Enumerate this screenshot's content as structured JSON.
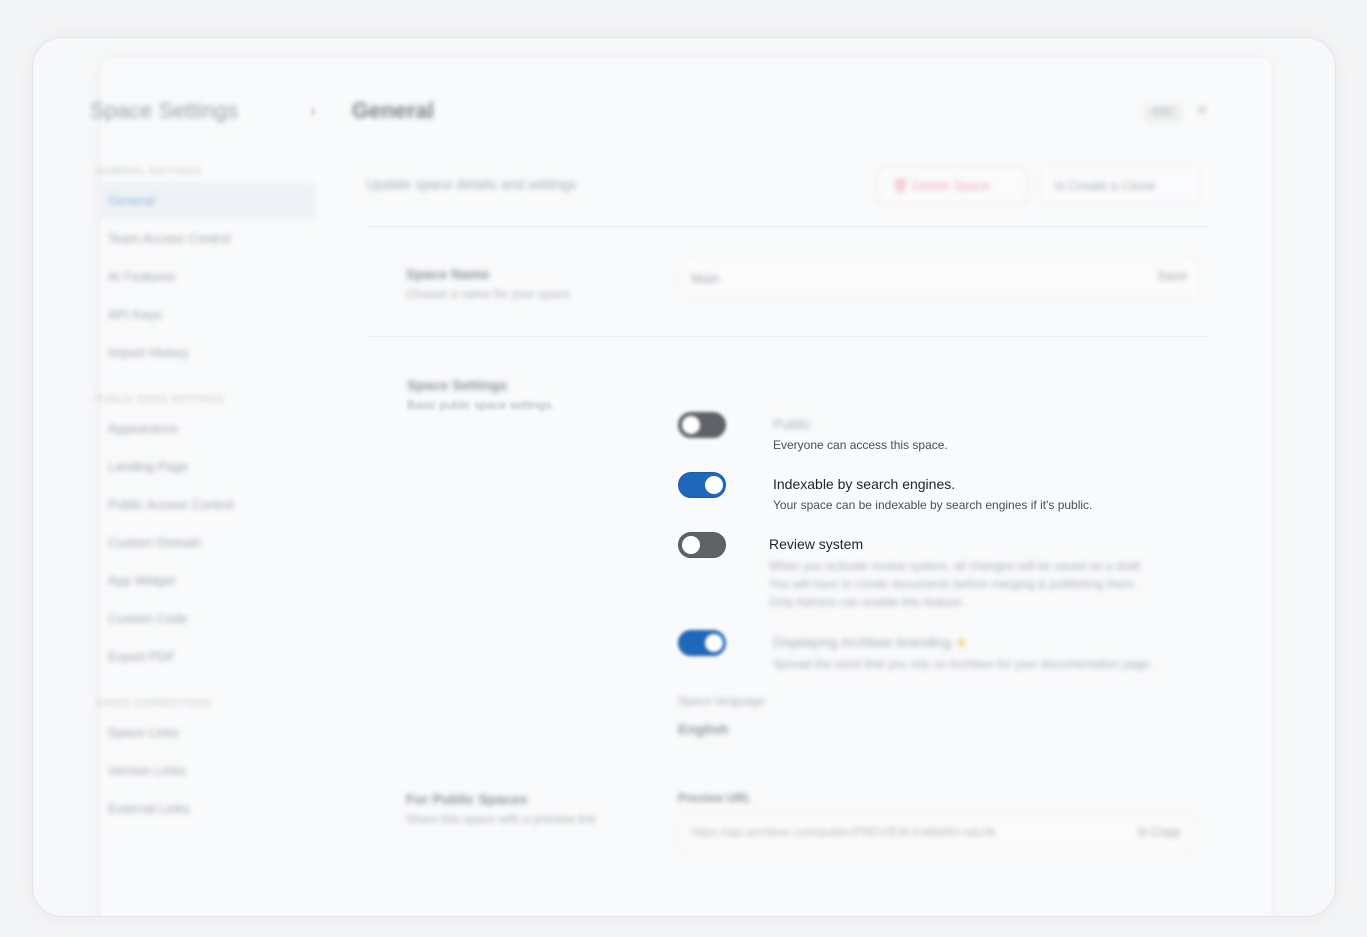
{
  "header": {
    "breadcrumb_root": "Space Settings",
    "breadcrumb_current": "General",
    "esc_label": "ESC"
  },
  "sidebar": {
    "sections": [
      {
        "title": "General Settings",
        "items": [
          "General",
          "Team Access Control",
          "AI Features",
          "API Keys",
          "Import History"
        ]
      },
      {
        "title": "Public Docs Settings",
        "items": [
          "Appearance",
          "Landing Page",
          "Public Access Control",
          "Custom Domain",
          "App Widget",
          "Custom Code",
          "Export PDF"
        ]
      },
      {
        "title": "Space Connections",
        "items": [
          "Space Links",
          "Version Links",
          "External Links"
        ]
      }
    ],
    "active": "General"
  },
  "main": {
    "subtitle": "Update space details and settings",
    "delete_label": "Delete Space",
    "clone_label": "Create a Clone",
    "space_name": {
      "title": "Space Name",
      "description": "Choose a name for your space",
      "value": "Main",
      "save_label": "Save"
    },
    "space_settings": {
      "title": "Space Settings",
      "description": "Basic public space settings.",
      "toggles": [
        {
          "label": "Public",
          "description": "Everyone can access this space.",
          "state": "off"
        },
        {
          "label": "Indexable by search engines.",
          "description": "Your space can be indexable by search engines if it's public.",
          "state": "on"
        },
        {
          "label": "Review system",
          "description_lines": [
            "When you activate review system, all changes will be saved as a draft.",
            "You will have to create documents before merging & publishing them.",
            "Only Admins can enable this feature."
          ],
          "state": "off"
        },
        {
          "label": "Displaying Archbee branding",
          "description": "Spread the word that you rely on Archbee for your documentation page.",
          "state": "on"
        }
      ],
      "language_label": "Space language",
      "language_value": "English"
    },
    "public_spaces": {
      "title": "For Public Spaces",
      "description": "Share this space with a preview link",
      "url_label": "Preview URL",
      "url_value": "https://api.archbee.com/public/PREVIEW-EaMd0H-sdu3k",
      "copy_label": "Copy"
    }
  }
}
